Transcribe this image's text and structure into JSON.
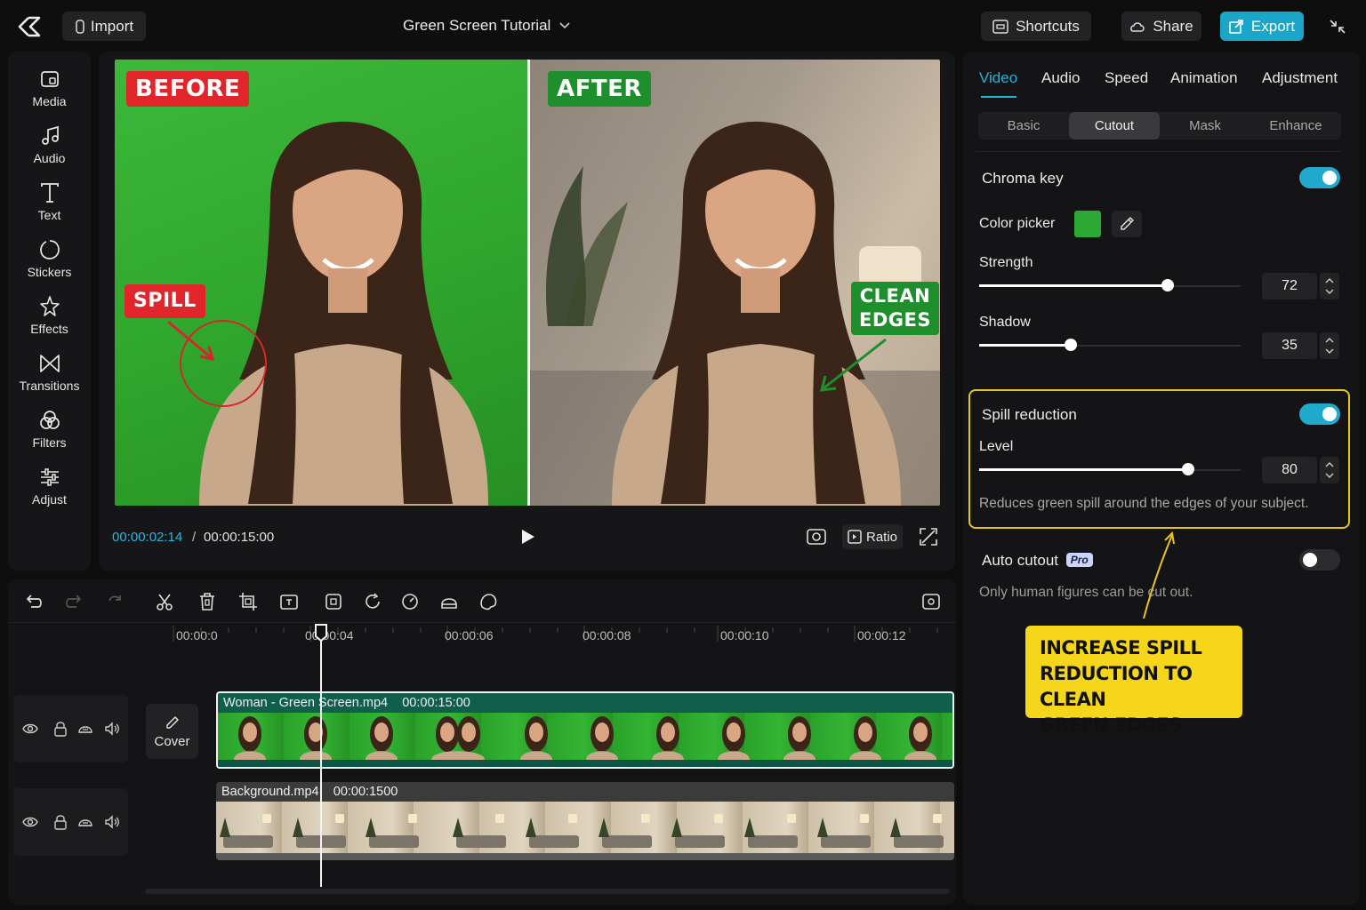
{
  "topbar": {
    "import_label": "Import",
    "project_title": "Green Screen Tutorial",
    "shortcuts_label": "Shortcuts",
    "share_label": "Share",
    "export_label": "Export"
  },
  "sidebar": {
    "items": [
      {
        "label": "Media",
        "icon": "media-icon"
      },
      {
        "label": "Audio",
        "icon": "audio-icon"
      },
      {
        "label": "Text",
        "icon": "text-icon"
      },
      {
        "label": "Stickers",
        "icon": "stickers-icon"
      },
      {
        "label": "Effects",
        "icon": "effects-icon"
      },
      {
        "label": "Transitions",
        "icon": "transitions-icon"
      },
      {
        "label": "Filters",
        "icon": "filters-icon"
      },
      {
        "label": "Adjust",
        "icon": "adjust-icon"
      }
    ]
  },
  "preview": {
    "before_tag": "BEFORE",
    "after_tag": "AFTER",
    "spill_tag": "SPILL",
    "clean_tag_line1": "CLEAN",
    "clean_tag_line2": "EDGES",
    "current_time": "00:00:02:14",
    "time_separator": "/",
    "total_time": "00:00:15:00",
    "ratio_label": "Ratio"
  },
  "panel": {
    "tabs": [
      "Video",
      "Audio",
      "Speed",
      "Animation",
      "Adjustment"
    ],
    "active_tab": "Video",
    "subtabs": [
      "Basic",
      "Cutout",
      "Mask",
      "Enhance"
    ],
    "active_subtab": "Cutout",
    "chroma_key": {
      "label": "Chroma key",
      "enabled": true
    },
    "color_picker": {
      "label": "Color picker",
      "color": "#2ba832"
    },
    "strength": {
      "label": "Strength",
      "value": "72",
      "fraction": 0.72
    },
    "shadow": {
      "label": "Shadow",
      "value": "35",
      "fraction": 0.35
    },
    "spill_reduction": {
      "label": "Spill reduction",
      "enabled": true,
      "level_label": "Level",
      "value": "80",
      "fraction": 0.8,
      "description": "Reduces green spill around the edges of your subject."
    },
    "auto_cutout": {
      "label": "Auto cutout",
      "badge": "Pro",
      "enabled": false,
      "note": "Only human figures can be cut out."
    },
    "callout": [
      "INCREASE SPILL",
      "REDUCTION TO CLEAN",
      "GREEN EDGES"
    ]
  },
  "timeline": {
    "ruler": [
      "00:00:0",
      "00:00:04",
      "00:00:06",
      "00:00:08",
      "00:00:10",
      "00:00:12"
    ],
    "cover_label": "Cover",
    "clips": [
      {
        "name": "Woman - Green Screen.mp4",
        "duration": "00:00:15:00"
      },
      {
        "name": "Background.mp4",
        "duration": "00:00:1500"
      }
    ]
  },
  "colors": {
    "accent": "#1aa6c9",
    "highlight": "#e8c61a",
    "before_tag": "#e0262a",
    "after_tag": "#1f8f2e"
  }
}
